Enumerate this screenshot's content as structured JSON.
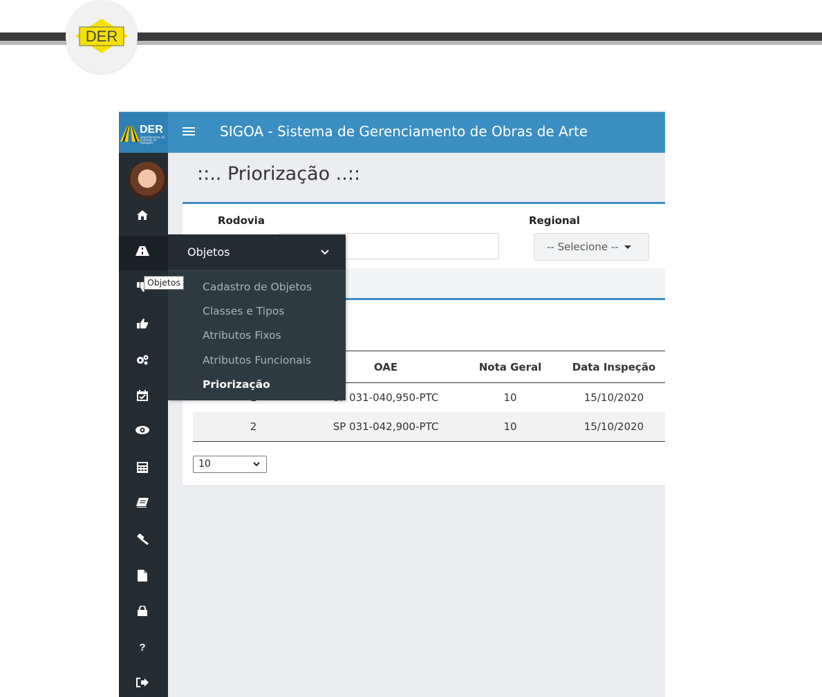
{
  "header": {
    "logo_text": "DER"
  },
  "app": {
    "brand": "DER",
    "brand_sub": "Departamento de Estradas de Rodagem",
    "title": "SIGOA - Sistema de Gerenciamento de Obras de Arte"
  },
  "sidebar": {
    "icons": [
      "home-icon",
      "road-icon",
      "thumbs-down-icon",
      "thumbs-up-icon",
      "gears-icon",
      "calendar-check-icon",
      "eye-icon",
      "calculator-icon",
      "book-icon",
      "gavel-icon",
      "file-icon",
      "lock-icon",
      "question-icon",
      "sign-out-icon"
    ]
  },
  "flyout": {
    "title": "Objetos",
    "items": [
      {
        "label": "Cadastro de Objetos",
        "active": false
      },
      {
        "label": "Classes e Tipos",
        "active": false
      },
      {
        "label": "Atributos Fixos",
        "active": false
      },
      {
        "label": "Atributos Funcionais",
        "active": false
      },
      {
        "label": "Priorização",
        "active": true
      }
    ]
  },
  "tooltip": "Objetos",
  "page": {
    "title": "::.. Priorização ..::"
  },
  "filters": {
    "rodovia_label": "Rodovia",
    "rodovia_value": "",
    "regional_label": "Regional",
    "regional_value": "-- Selecione --"
  },
  "table": {
    "columns": [
      "",
      "OAE",
      "Nota Geral",
      "Data Inspeção"
    ],
    "rows": [
      {
        "num": "1",
        "oae": "SP 031-040,950-PTC",
        "nota": "10",
        "data": "15/10/2020"
      },
      {
        "num": "2",
        "oae": "SP 031-042,900-PTC",
        "nota": "10",
        "data": "15/10/2020"
      }
    ]
  },
  "pagination": {
    "page_size": "10"
  },
  "colors": {
    "topbar": "#3b8ec2",
    "sidebar": "#232d33",
    "accent_border": "#3b8ec2"
  }
}
